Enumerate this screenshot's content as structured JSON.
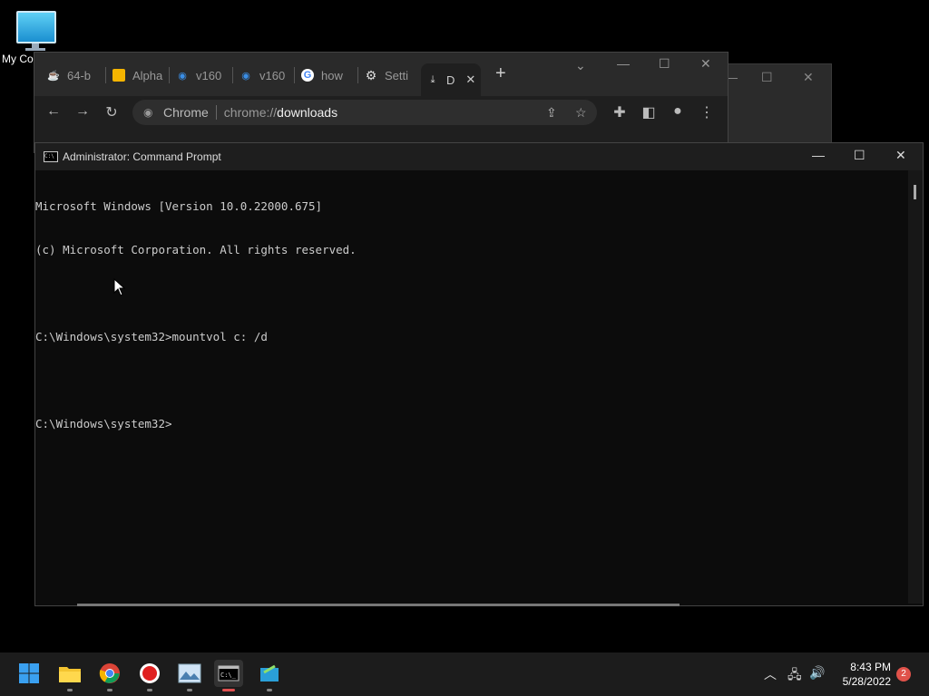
{
  "desktop": {
    "icon_label": "My Co"
  },
  "chrome": {
    "tabs": [
      {
        "label": "64-b",
        "icon": "java-icon"
      },
      {
        "label": "Alpha",
        "icon": "slides-icon"
      },
      {
        "label": "v160",
        "icon": "edge-icon"
      },
      {
        "label": "v160",
        "icon": "edge-icon"
      },
      {
        "label": "how",
        "icon": "google-icon"
      },
      {
        "label": "Setti",
        "icon": "gear-icon"
      },
      {
        "label": "D",
        "icon": "download-icon"
      }
    ],
    "site_label": "Chrome",
    "url_prefix": "chrome://",
    "url_main": "downloads"
  },
  "cmd": {
    "title": "Administrator: Command Prompt",
    "lines": [
      "Microsoft Windows [Version 10.0.22000.675]",
      "(c) Microsoft Corporation. All rights reserved.",
      "",
      "C:\\Windows\\system32>mountvol c: /d",
      "",
      "C:\\Windows\\system32>"
    ]
  },
  "taskbar": {
    "time": "8:43 PM",
    "date": "5/28/2022",
    "notifications": "2"
  },
  "colors": {
    "console_bg": "#0c0c0c",
    "console_text": "#cccccc",
    "taskbar_bg": "#1c1c1c",
    "notification_badge": "#e0524a"
  }
}
